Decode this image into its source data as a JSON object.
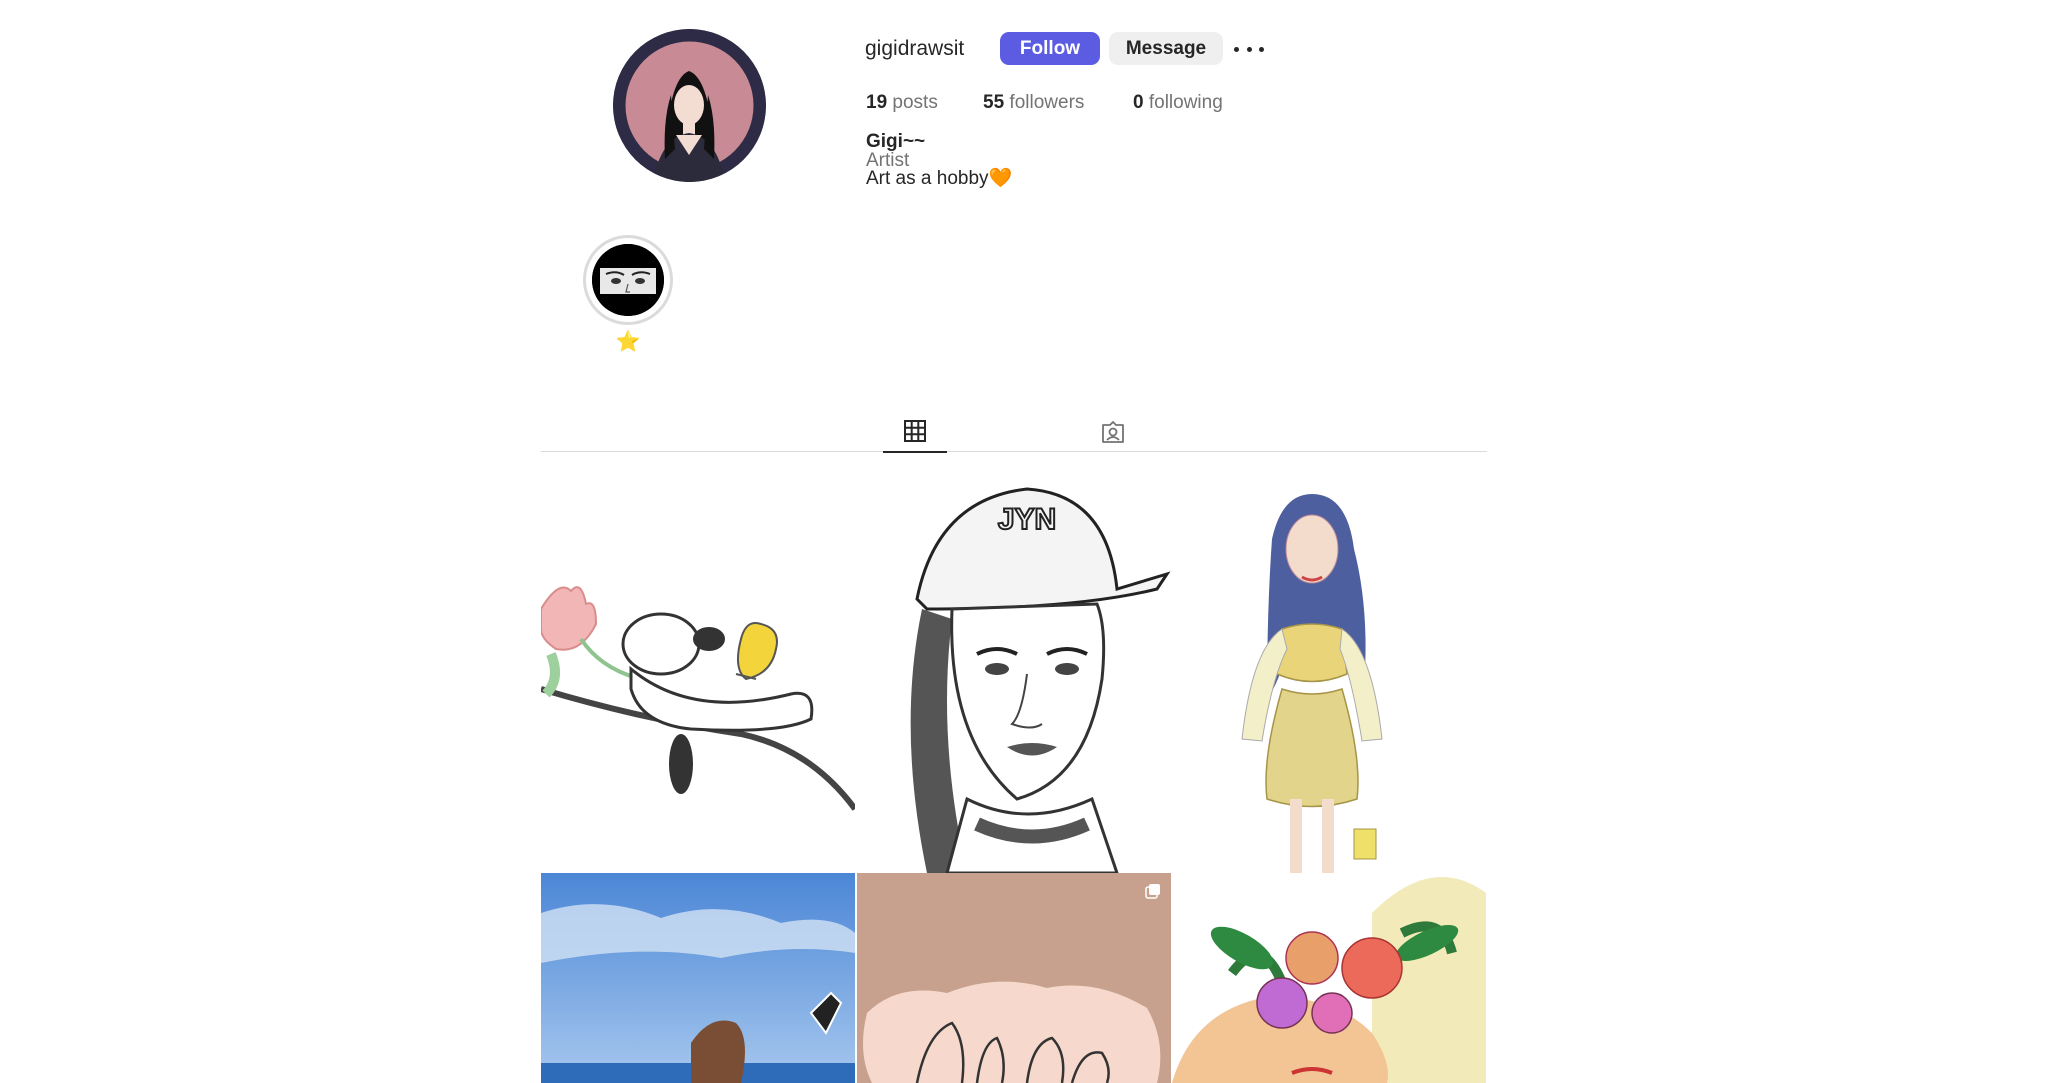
{
  "profile": {
    "username": "gigidrawsit",
    "follow_label": "Follow",
    "message_label": "Message",
    "more_icon": "more-horizontal-icon",
    "posts_count": "19",
    "posts_label": "posts",
    "followers_count": "55",
    "followers_label": "followers",
    "following_count": "0",
    "following_label": "following",
    "full_name": "Gigi~~",
    "category": "Artist",
    "bio": "Art as a hobby🧡"
  },
  "highlights": [
    {
      "label": "⭐️"
    }
  ],
  "tabs": [
    {
      "icon": "grid-icon",
      "active": true
    },
    {
      "icon": "tagged-icon",
      "active": false
    }
  ],
  "colors": {
    "follow_button": "#5b5ce2",
    "message_button": "#efefef",
    "muted_text": "#737373"
  },
  "posts": [
    {
      "subject": "snoopy-woodstock-drawing"
    },
    {
      "subject": "girl-nyc-cap-sketch"
    },
    {
      "subject": "fashion-yellow-outfit"
    },
    {
      "subject": "girl-by-the-sea"
    },
    {
      "subject": "pinky-promise-hands",
      "multiple": true
    },
    {
      "subject": "flowers-crown-portrait"
    }
  ]
}
